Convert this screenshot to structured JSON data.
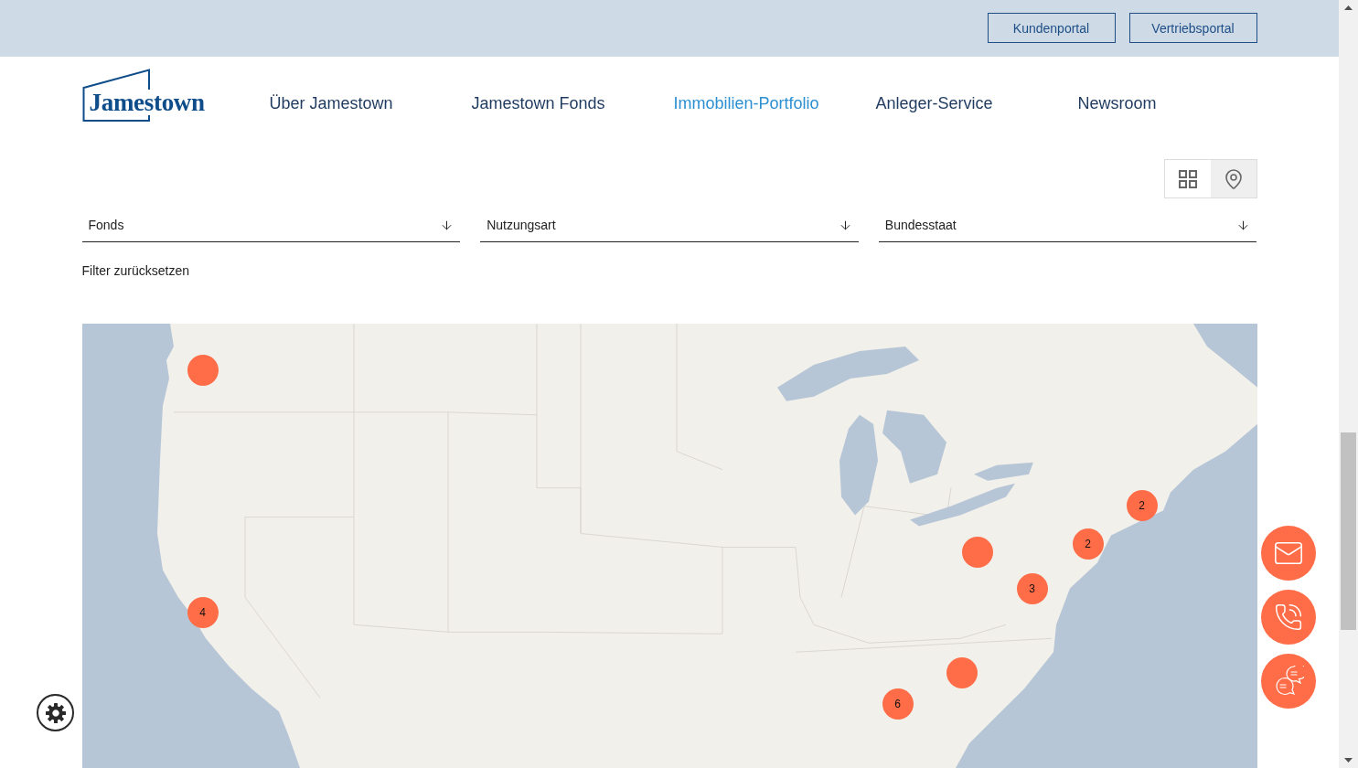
{
  "top_bar": {
    "buttons": [
      "Kundenportal",
      "Vertriebsportal"
    ]
  },
  "header": {
    "logo": "Jamestown",
    "nav": [
      {
        "label": "Über Jamestown",
        "selected": false
      },
      {
        "label": "Jamestown Fonds",
        "selected": false
      },
      {
        "label": "Immobilien-Portfolio",
        "selected": true
      },
      {
        "label": "Anleger-Service",
        "selected": false
      },
      {
        "label": "Newsroom",
        "selected": false
      }
    ]
  },
  "view_toggle": [
    {
      "kind": "grid",
      "selected": false
    },
    {
      "kind": "map",
      "selected": true
    }
  ],
  "filters": [
    {
      "label": "Fonds"
    },
    {
      "label": "Nutzungsart"
    },
    {
      "label": "Bundesstaat"
    }
  ],
  "reset_link": "Filter zurücksetzen",
  "map": {
    "markers": [
      {
        "kind": "single"
      },
      {
        "kind": "cluster",
        "count": "2"
      },
      {
        "kind": "cluster",
        "count": "2"
      },
      {
        "kind": "single"
      },
      {
        "kind": "cluster",
        "count": "3"
      },
      {
        "kind": "cluster",
        "count": "4"
      },
      {
        "kind": "single"
      },
      {
        "kind": "cluster",
        "count": "6"
      }
    ]
  },
  "floating_actions": [
    {
      "kind": "mail"
    },
    {
      "kind": "phone"
    },
    {
      "kind": "chat"
    }
  ]
}
